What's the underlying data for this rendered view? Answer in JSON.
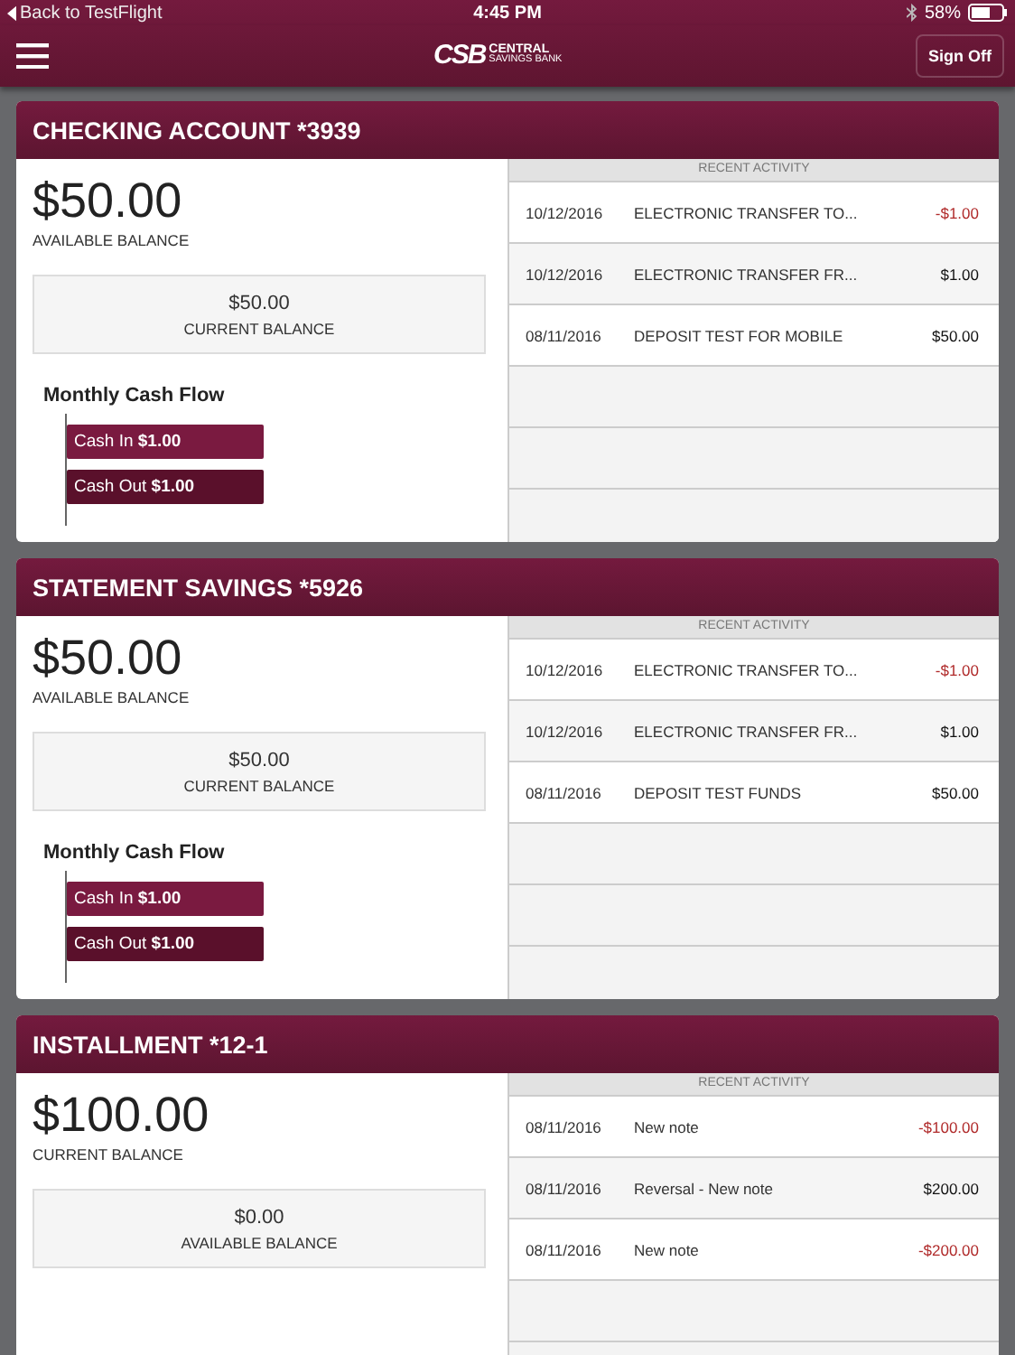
{
  "status_bar": {
    "back": "Back to TestFlight",
    "time": "4:45 PM",
    "battery": "58%"
  },
  "nav": {
    "logo_mark": "CSB",
    "logo_line1": "CENTRAL",
    "logo_line2": "SAVINGS BANK",
    "sign_off": "Sign Off"
  },
  "accounts": [
    {
      "title": "CHECKING ACCOUNT *3939",
      "balance": "$50.00",
      "balance_label": "AVAILABLE BALANCE",
      "secondary": "$50.00",
      "secondary_label": "CURRENT BALANCE",
      "cash_flow": {
        "title": "Monthly Cash Flow",
        "bars": [
          {
            "kind": "in",
            "label": "Cash In **$1.00**"
          },
          {
            "kind": "out",
            "label": "Cash Out **$1.00**"
          }
        ]
      },
      "activity_header": "RECENT ACTIVITY",
      "activity": [
        {
          "date": "10/12/2016",
          "description": "ELECTRONIC TRANSFER TO...",
          "amount": "-$1.00",
          "negative": true
        },
        {
          "date": "10/12/2016",
          "description": "ELECTRONIC TRANSFER FR...",
          "amount": "$1.00",
          "negative": false
        },
        {
          "date": "08/11/2016",
          "description": "DEPOSIT TEST FOR MOBILE",
          "amount": "$50.00",
          "negative": false
        }
      ]
    },
    {
      "title": "STATEMENT SAVINGS *5926",
      "balance": "$50.00",
      "balance_label": "AVAILABLE BALANCE",
      "secondary": "$50.00",
      "secondary_label": "CURRENT BALANCE",
      "cash_flow": {
        "title": "Monthly Cash Flow",
        "bars": [
          {
            "kind": "in",
            "label": "Cash In **$1.00**"
          },
          {
            "kind": "out",
            "label": "Cash Out **$1.00**"
          }
        ]
      },
      "activity_header": "RECENT ACTIVITY",
      "activity": [
        {
          "date": "10/12/2016",
          "description": "ELECTRONIC TRANSFER TO...",
          "amount": "-$1.00",
          "negative": true
        },
        {
          "date": "10/12/2016",
          "description": "ELECTRONIC TRANSFER FR...",
          "amount": "$1.00",
          "negative": false
        },
        {
          "date": "08/11/2016",
          "description": "DEPOSIT TEST FUNDS",
          "amount": "$50.00",
          "negative": false
        }
      ]
    },
    {
      "title": "INSTALLMENT *12-1",
      "balance": "$100.00",
      "balance_label": "CURRENT BALANCE",
      "secondary": "$0.00",
      "secondary_label": "AVAILABLE BALANCE",
      "activity_header": "RECENT ACTIVITY",
      "activity": [
        {
          "date": "08/11/2016",
          "description": "New note",
          "amount": "-$100.00",
          "negative": true
        },
        {
          "date": "08/11/2016",
          "description": "Reversal - New note",
          "amount": "$200.00",
          "negative": false
        },
        {
          "date": "08/11/2016",
          "description": "New note",
          "amount": "-$200.00",
          "negative": true
        }
      ]
    }
  ]
}
